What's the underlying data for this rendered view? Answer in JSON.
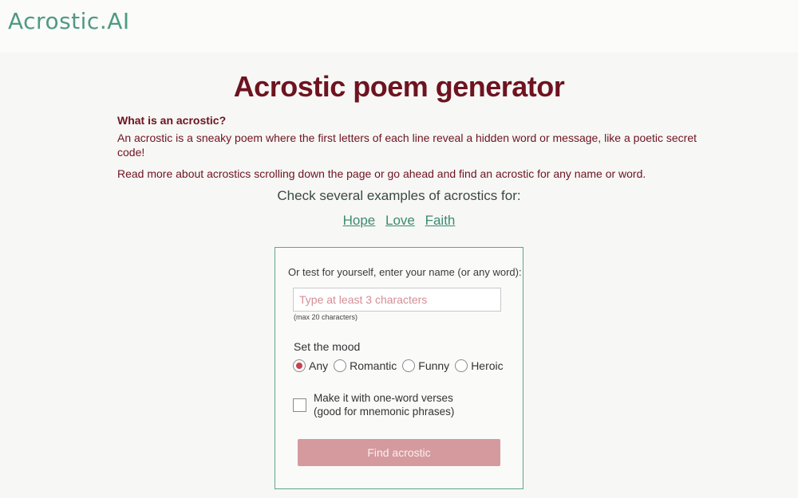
{
  "header": {
    "logo": "Acrostic.AI"
  },
  "page": {
    "title": "Acrostic poem generator",
    "intro_question": "What is an acrostic?",
    "intro_text": "An acrostic is a sneaky poem where the first letters of each line reveal a hidden word or message, like a poetic secret code!",
    "intro_more": "Read more about acrostics scrolling down the page or go ahead and find an acrostic for any name or word."
  },
  "examples": {
    "heading": "Check several examples of acrostics for:",
    "links": [
      "Hope",
      "Love",
      "Faith"
    ]
  },
  "form": {
    "prompt": "Or test for yourself, enter your name (or any word):",
    "input_value": "",
    "input_placeholder": "Type at least 3 characters",
    "hint": "(max 20 characters)",
    "mood_label": "Set the mood",
    "moods": [
      "Any",
      "Romantic",
      "Funny",
      "Heroic"
    ],
    "selected_mood": "Any",
    "checkbox_line1": "Make it with one-word verses",
    "checkbox_line2": "(good for mnemonic phrases)",
    "checkbox_checked": false,
    "submit_label": "Find acrostic"
  },
  "colors": {
    "brand": "#4e9a84",
    "title": "#6e1320",
    "link": "#3e8a72",
    "button": "#d49a9e"
  }
}
